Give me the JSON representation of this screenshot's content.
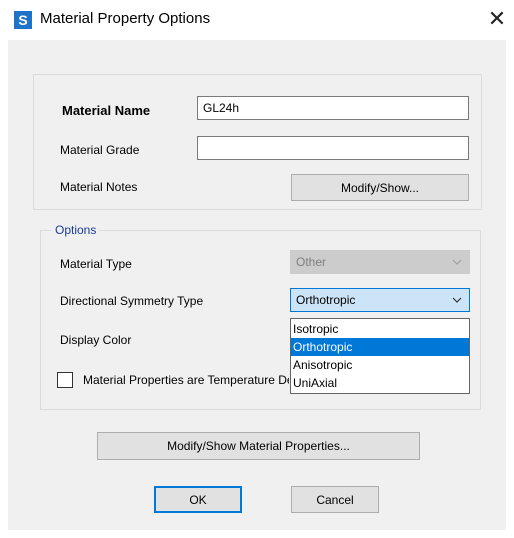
{
  "window": {
    "app_icon": "S",
    "title": "Material Property Options",
    "close_icon": "✕"
  },
  "material": {
    "name_label": "Material Name",
    "name_value": "GL24h",
    "grade_label": "Material Grade",
    "grade_value": "",
    "notes_label": "Material Notes",
    "notes_button": "Modify/Show..."
  },
  "options": {
    "legend": "Options",
    "type_label": "Material Type",
    "type_value": "Other",
    "symmetry_label": "Directional Symmetry Type",
    "symmetry_value": "Orthotropic",
    "symmetry_options": [
      "Isotropic",
      "Orthotropic",
      "Anisotropic",
      "UniAxial"
    ],
    "symmetry_selected_index": 1,
    "display_color_label": "Display Color",
    "temperature_checkbox_label": "Material Properties are Temperature Dependent",
    "temperature_checked": false
  },
  "buttons": {
    "modify_properties": "Modify/Show Material Properties...",
    "ok": "OK",
    "cancel": "Cancel"
  }
}
